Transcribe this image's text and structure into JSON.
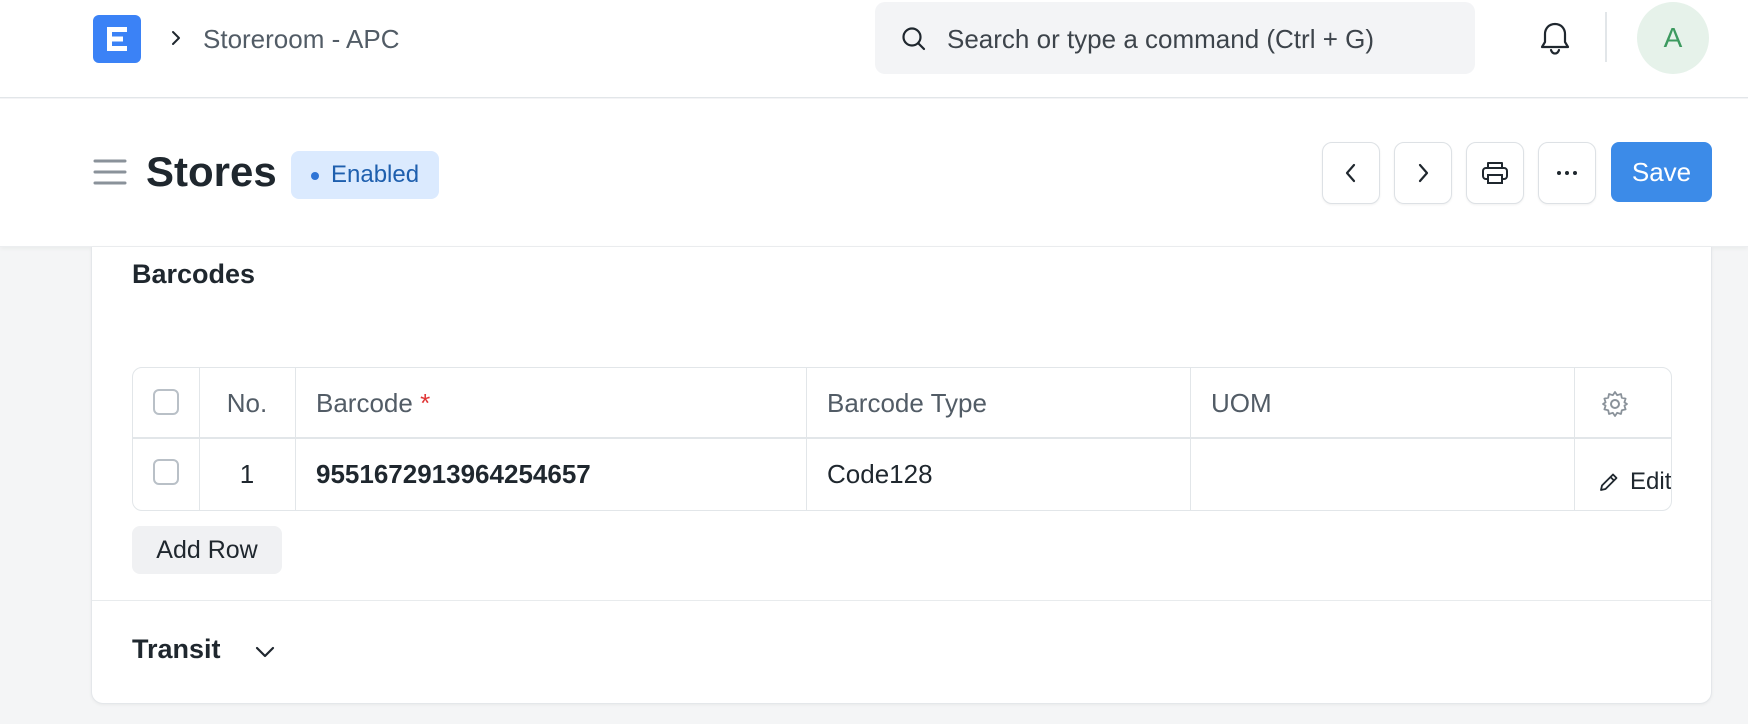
{
  "navbar": {
    "logo_letter": "E",
    "breadcrumb": "Storeroom - APC",
    "search_placeholder": "Search or type a command (Ctrl + G)",
    "avatar_initial": "A"
  },
  "header": {
    "title": "Stores",
    "status": "Enabled",
    "save_label": "Save"
  },
  "barcodes": {
    "section_title": "Barcodes",
    "columns": {
      "no": "No.",
      "barcode": "Barcode",
      "required_mark": "*",
      "barcode_type": "Barcode Type",
      "uom": "UOM"
    },
    "rows": [
      {
        "no": "1",
        "barcode": "9551672913964254657",
        "barcode_type": "Code128",
        "uom": "",
        "edit_label": "Edit"
      }
    ],
    "add_row_label": "Add Row"
  },
  "transit": {
    "section_title": "Transit"
  },
  "colors": {
    "accent": "#3c8be8",
    "logo": "#3b82f6",
    "badge_bg": "#dbeafe",
    "badge_text": "#1e5fae",
    "required": "#e03636"
  },
  "icons": [
    "app-logo",
    "chevron-right-icon",
    "search-icon",
    "bell-icon",
    "hamburger-icon",
    "chevron-left-icon",
    "printer-icon",
    "more-icon",
    "gear-icon",
    "pencil-icon",
    "chevron-down-icon"
  ]
}
